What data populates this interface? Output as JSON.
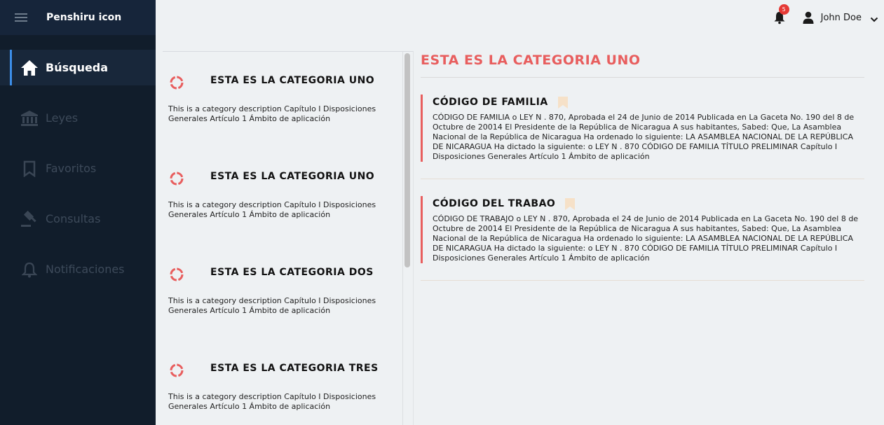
{
  "app": {
    "brand": "Penshiru icon"
  },
  "sidebar": {
    "items": [
      {
        "label": "Búsqueda",
        "icon": "home-icon",
        "active": true
      },
      {
        "label": "Leyes",
        "icon": "institution-icon",
        "active": false
      },
      {
        "label": "Favoritos",
        "icon": "bookmark-icon",
        "active": false
      },
      {
        "label": "Consultas",
        "icon": "gavel-icon",
        "active": false
      },
      {
        "label": "Notificaciones",
        "icon": "bell-icon",
        "active": false
      }
    ]
  },
  "header": {
    "notification_count": "5",
    "user_name": "John Doe"
  },
  "categories": [
    {
      "title": "ESTA ES LA CATEGORIA UNO",
      "description": "This is a category description Capítulo I Disposiciones Generales Artículo 1 Ámbito de aplicación"
    },
    {
      "title": "ESTA ES LA CATEGORIA UNO",
      "description": "This is a category description Capítulo I Disposiciones Generales Artículo 1 Ámbito de aplicación"
    },
    {
      "title": "ESTA ES LA CATEGORIA DOS",
      "description": "This is a category description Capítulo I Disposiciones Generales Artículo 1 Ámbito de aplicación"
    },
    {
      "title": "ESTA ES LA CATEGORIA TRES",
      "description": "This is a category description Capítulo I Disposiciones Generales Artículo 1 Ámbito de aplicación"
    }
  ],
  "detail": {
    "title": "ESTA ES LA CATEGORIA UNO",
    "laws": [
      {
        "title": "CÓDIGO DE FAMILIA",
        "text": "CÓDIGO DE FAMILIA o LEY N . 870, Aprobada el 24 de Junio de 2014 Publicada en La Gaceta No. 190 del 8 de Octubre de 20014 El Presidente de la República de Nicaragua A sus habitantes, Sabed: Que, La Asamblea Nacional de la República de Nicaragua Ha ordenado lo siguiente: LA ASAMBLEA NACIONAL DE LA REPÚBLICA DE NICARAGUA Ha dictado la siguiente: o LEY N . 870 CÓDIGO DE FAMILIA TÍTULO PRELIMINAR Capítulo I Disposiciones Generales Artículo 1 Ámbito de aplicación"
      },
      {
        "title": "CÓDIGO DEL TRABAO",
        "text": "CÓDIGO DE TRABAJO o LEY N . 870, Aprobada el 24 de Junio de 2014 Publicada en La Gaceta No. 190 del 8 de Octubre de 20014 El Presidente de la República de Nicaragua A sus habitantes, Sabed: Que, La Asamblea Nacional de la República de Nicaragua Ha ordenado lo siguiente: LA ASAMBLEA NACIONAL DE LA REPÚBLICA DE NICARAGUA Ha dictado la siguiente: o LEY N . 870 CÓDIGO DE FAMILIA TÍTULO PRELIMINAR Capítulo I Disposiciones Generales Artículo 1 Ámbito de aplicación"
      }
    ]
  },
  "colors": {
    "accent": "#e85e5e",
    "sidebar_bg": "#111d2b",
    "active_bar": "#3c8ee8",
    "bookmark": "#f6e1c8"
  }
}
